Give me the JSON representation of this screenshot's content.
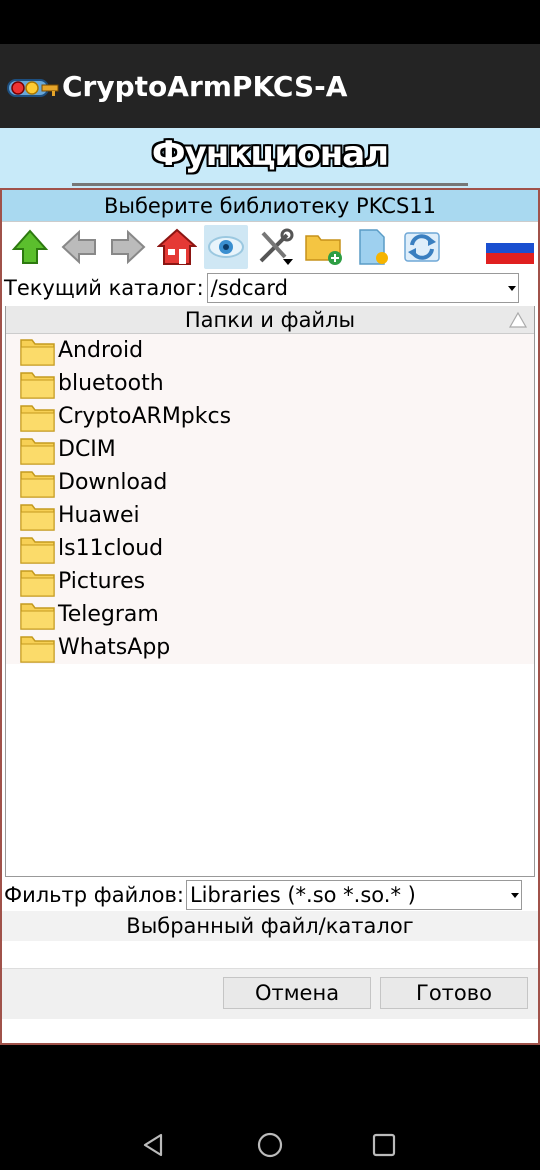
{
  "app": {
    "title": "CryptoArmPKCS-A"
  },
  "section": {
    "title": "Функционал"
  },
  "dialog": {
    "title": "Выберите библиотеку PKCS11",
    "toolbar": {
      "buttons": [
        "up-icon",
        "back-icon",
        "forward-icon",
        "home-icon",
        "view-icon",
        "tools-icon",
        "new-folder-icon",
        "new-file-icon",
        "refresh-icon",
        "russian-flag-icon"
      ]
    },
    "current_dir": {
      "label": "Текущий каталог:",
      "value": "/sdcard"
    },
    "list": {
      "header": "Папки и файлы",
      "items": [
        "Android",
        "bluetooth",
        "CryptoARMpkcs",
        "DCIM",
        "Download",
        "Huawei",
        "ls11cloud",
        "Pictures",
        "Telegram",
        "WhatsApp"
      ]
    },
    "filter": {
      "label": "Фильтр файлов:",
      "value": "Libraries (*.so *.so.* )"
    },
    "selected": {
      "label": "Выбранный файл/каталог",
      "value": ""
    },
    "buttons": {
      "cancel": "Отмена",
      "done": "Готово"
    }
  },
  "colors": {
    "section_bg": "#c8eaf9",
    "dialog_title_bg": "#a9d9f0",
    "dialog_border": "#a0524a",
    "app_bar": "#242424"
  }
}
